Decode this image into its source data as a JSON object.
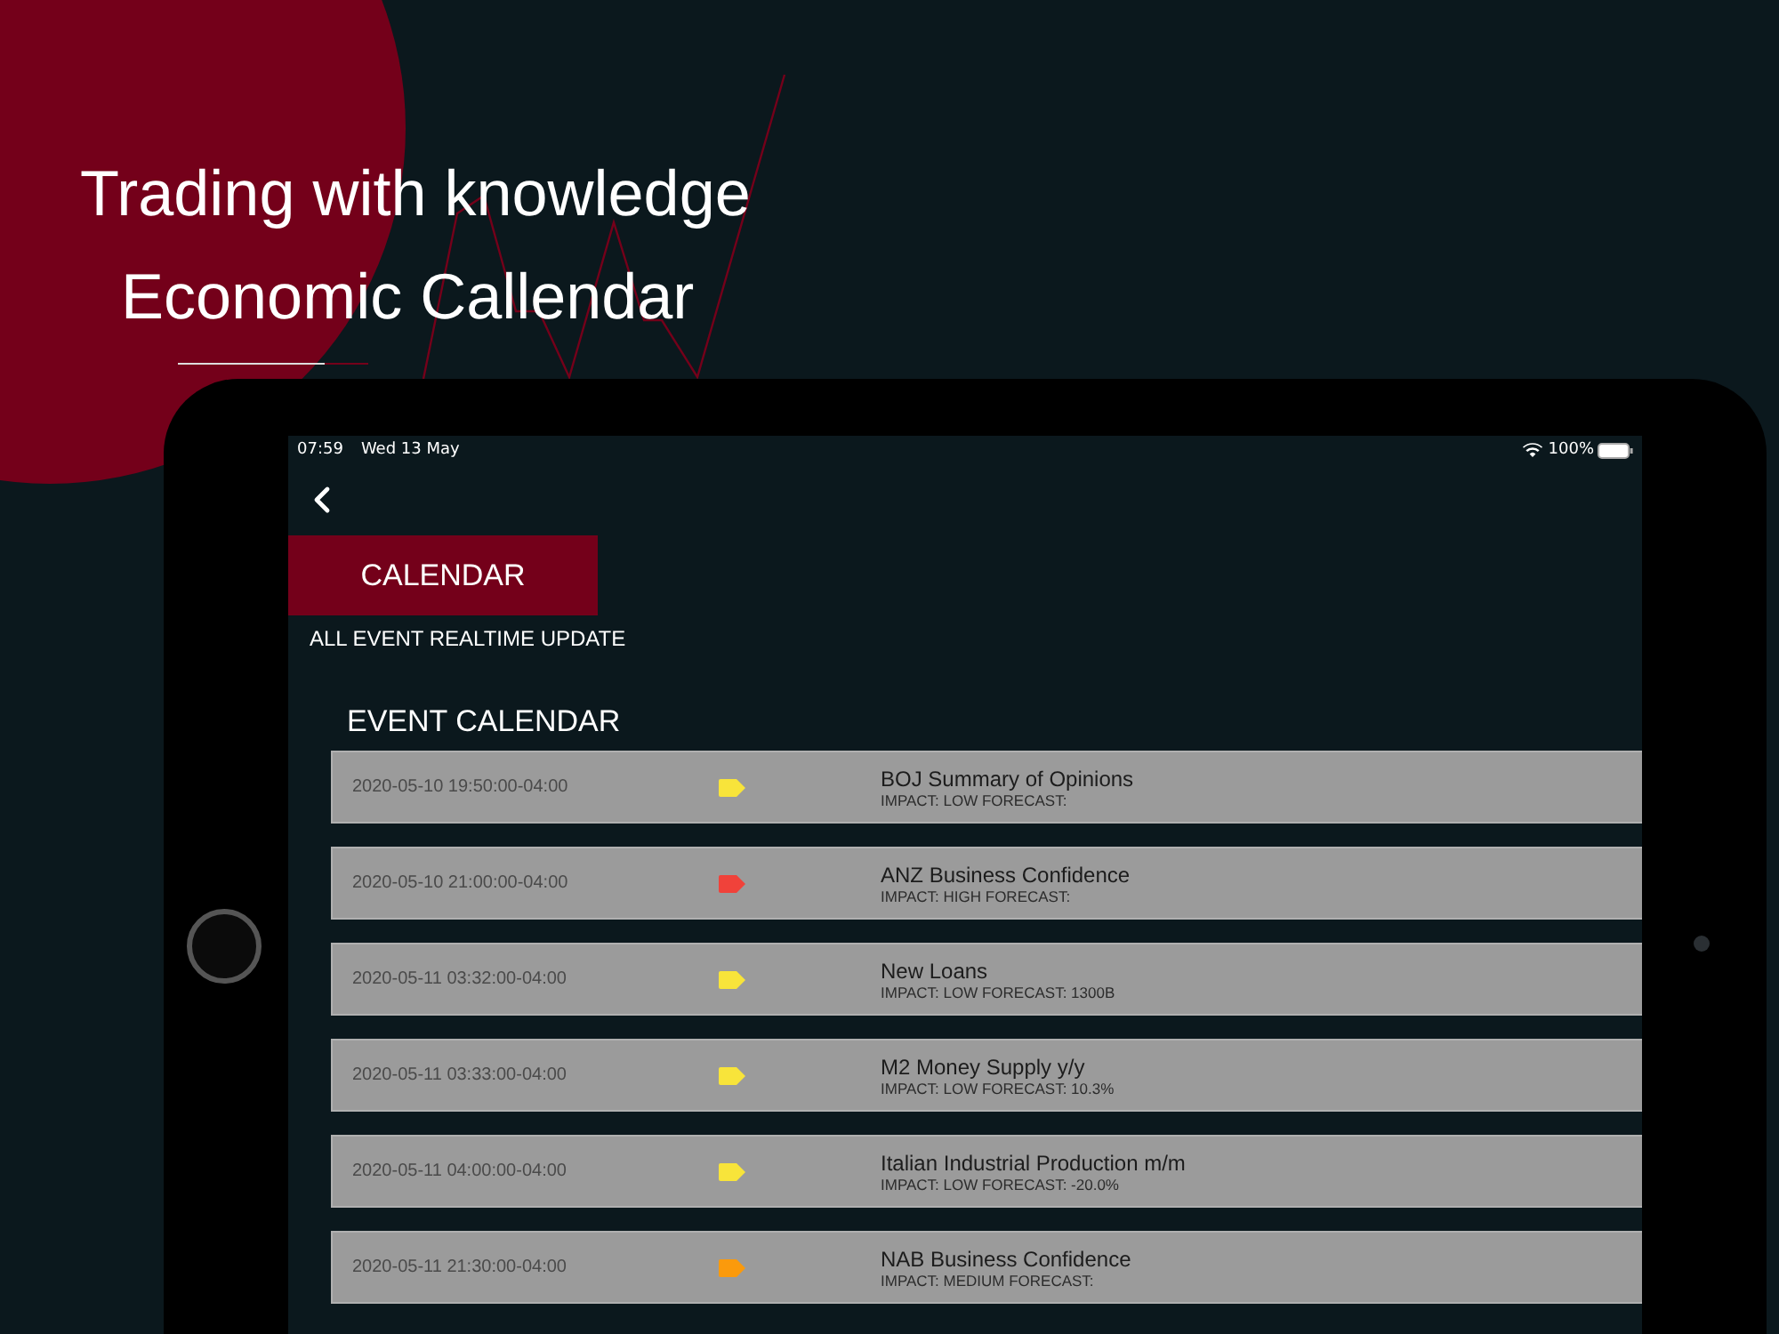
{
  "hero": {
    "lines": [
      "Trading with knowledge",
      "Economic Callendar"
    ]
  },
  "status_bar": {
    "time": "07:59",
    "date": "Wed 13 May",
    "battery": "100%"
  },
  "header": {
    "title": "CALENDAR",
    "subtitle": "ALL EVENT REALTIME UPDATE"
  },
  "section_title": "EVENT CALENDAR",
  "events": [
    {
      "datetime": "2020-05-10 19:50:00-04:00",
      "color": "#f8e43a",
      "title": "BOJ Summary of Opinions",
      "detail": "IMPACT: LOW FORECAST:"
    },
    {
      "datetime": "2020-05-10 21:00:00-04:00",
      "color": "#f0423a",
      "title": "ANZ Business Confidence",
      "detail": "IMPACT: HIGH FORECAST:"
    },
    {
      "datetime": "2020-05-11 03:32:00-04:00",
      "color": "#f8e43a",
      "title": "New Loans",
      "detail": "IMPACT: LOW FORECAST: 1300B"
    },
    {
      "datetime": "2020-05-11 03:33:00-04:00",
      "color": "#f8e43a",
      "title": "M2 Money Supply y/y",
      "detail": "IMPACT: LOW FORECAST: 10.3%"
    },
    {
      "datetime": "2020-05-11 04:00:00-04:00",
      "color": "#f8e43a",
      "title": "Italian Industrial Production m/m",
      "detail": "IMPACT: LOW FORECAST: -20.0%"
    },
    {
      "datetime": "2020-05-11 21:30:00-04:00",
      "color": "#fb9a0c",
      "title": "NAB Business Confidence",
      "detail": "IMPACT: MEDIUM FORECAST:"
    }
  ]
}
